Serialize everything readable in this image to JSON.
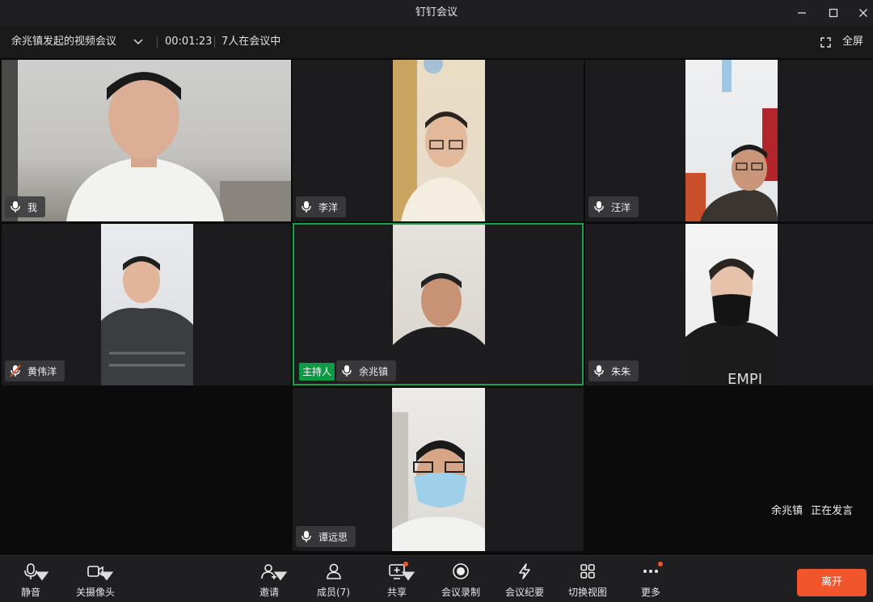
{
  "window": {
    "title": "钉钉会议"
  },
  "infobar": {
    "meeting_name": "余兆镇发起的视频会议",
    "duration": "00:01:23",
    "participants_in_meeting": "7人在会议中",
    "fullscreen_label": "全屏"
  },
  "tiles": [
    {
      "name": "我",
      "mic": "mic-icon",
      "muted": false,
      "host": false
    },
    {
      "name": "李洋",
      "mic": "mic-icon",
      "muted": false,
      "host": false
    },
    {
      "name": "汪洋",
      "mic": "mic-icon",
      "muted": false,
      "host": false
    },
    {
      "name": "黄伟洋",
      "mic": "mic-muted-icon",
      "muted": true,
      "host": false
    },
    {
      "name": "余兆镇",
      "mic": "mic-icon",
      "muted": false,
      "host": true,
      "host_label": "主持人",
      "active_speaker": true
    },
    {
      "name": "朱朱",
      "mic": "mic-icon",
      "muted": false,
      "host": false
    },
    {
      "name": "谭远思",
      "mic": "mic-icon",
      "muted": false,
      "host": false
    }
  ],
  "speaking_status": {
    "speaker": "余兆镇",
    "text": "正在发言"
  },
  "toolbar": {
    "mute": "静音",
    "camera_off": "关摄像头",
    "invite": "邀请",
    "members": "成员(7)",
    "share": "共享",
    "record": "会议录制",
    "minutes": "会议纪要",
    "switch_view": "切换视图",
    "more": "更多",
    "leave": "离开"
  },
  "colors": {
    "accent_green": "#15a14a",
    "leave_red": "#f0552b",
    "background": "#0b0b0c",
    "tile_background": "#1c1c1e"
  }
}
